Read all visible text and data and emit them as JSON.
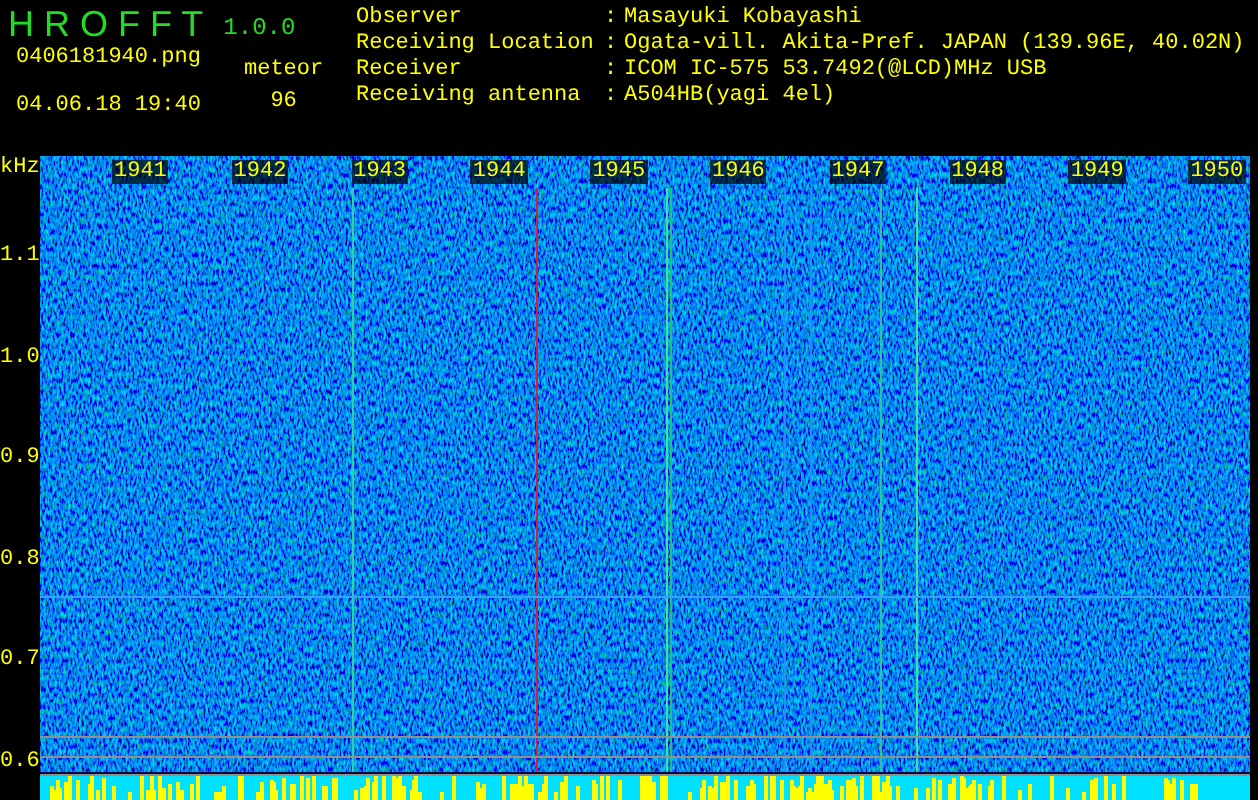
{
  "header": {
    "app_name": "H R O F F T",
    "version": "1.0.0",
    "filename": "0406181940.png",
    "timestamp": "04.06.18 19:40",
    "count_label": "meteor",
    "count": "96"
  },
  "info": [
    {
      "label": "Observer",
      "colon": ":",
      "value": "Masayuki Kobayashi"
    },
    {
      "label": "Receiving Location",
      "colon": ":",
      "value": "Ogata-vill. Akita-Pref. JAPAN (139.96E, 40.02N)"
    },
    {
      "label": "Receiver",
      "colon": ":",
      "value": "ICOM IC-575 53.7492(@LCD)MHz USB"
    },
    {
      "label": "Receiving antenna",
      "colon": ":",
      "value": "A504HB(yagi 4el)"
    }
  ],
  "spectrogram": {
    "unit": "kHz",
    "y_labels": [
      "1.1",
      "1.0",
      "0.9",
      "0.8",
      "0.7",
      "0.6"
    ],
    "time_labels": [
      "1941",
      "1942",
      "1943",
      "1944",
      "1945",
      "1946",
      "1947",
      "1948",
      "1949",
      "1950"
    ]
  }
}
